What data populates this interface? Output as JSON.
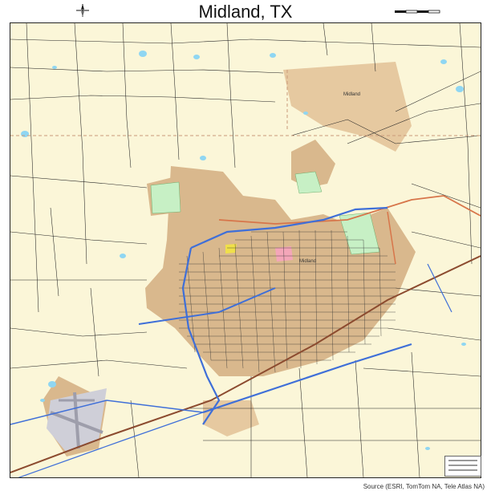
{
  "map": {
    "title": "Midland, TX",
    "source": "Source (ESRI, TomTom NA, Tele Atlas NA)",
    "labels": {
      "county_area": "Midland",
      "downtown": "Midland"
    },
    "colors": {
      "background": "#fbf6d8",
      "urban": "#d9b88d",
      "water": "#8fd6f2",
      "park": "#c7f0c5",
      "airport": "#cfcfd8",
      "highway": "#3f6fd8",
      "major_road": "#d7754a",
      "rail": "#8c4b2f"
    },
    "icons": {
      "north_arrow": "compass-north-icon",
      "scale": "scale-bar"
    }
  }
}
